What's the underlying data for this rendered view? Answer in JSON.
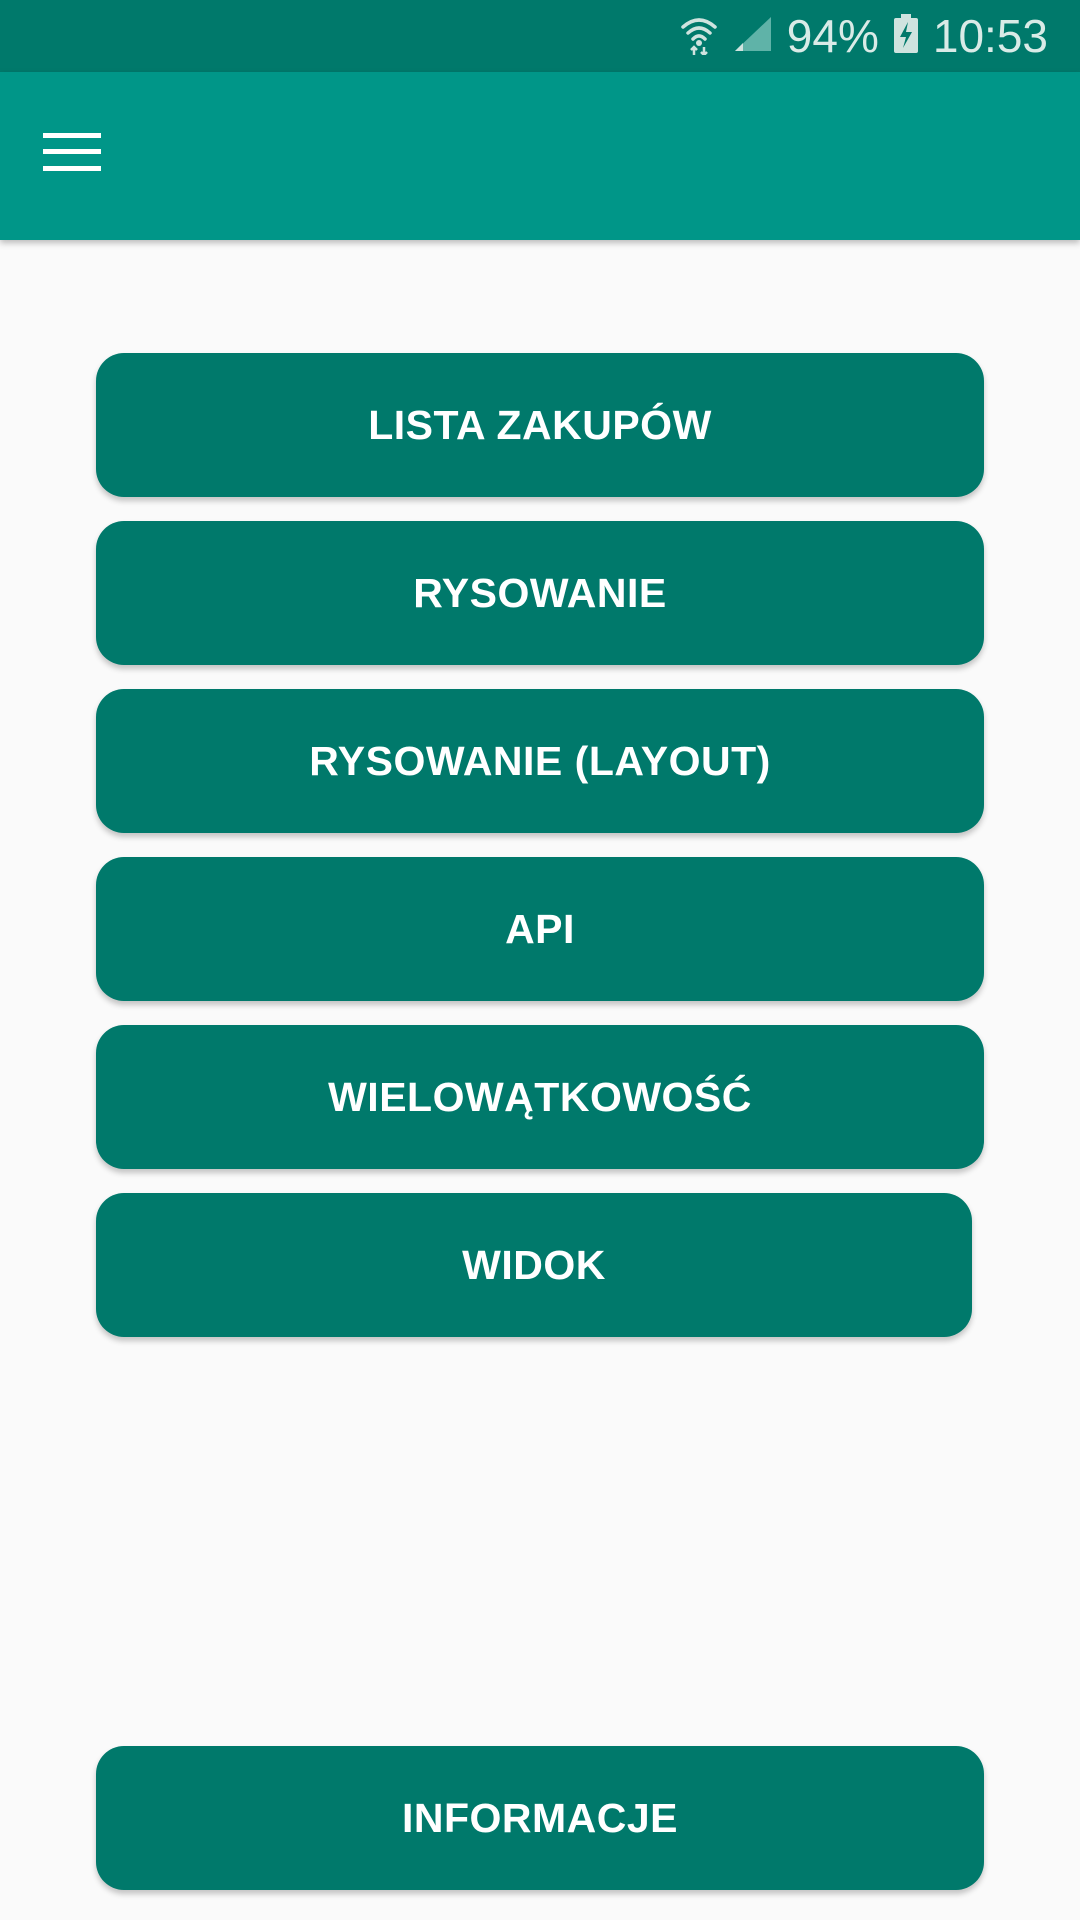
{
  "status_bar": {
    "battery": "94%",
    "time": "10:53",
    "icons": [
      "wifi-icon",
      "signal-icon",
      "battery-charging-icon"
    ]
  },
  "app_bar": {
    "menu_icon": "hamburger-menu-icon",
    "color": "#009688"
  },
  "buttons": [
    {
      "label": "LISTA ZAKUPÓW"
    },
    {
      "label": "RYSOWANIE"
    },
    {
      "label": "RYSOWANIE (LAYOUT)"
    },
    {
      "label": "API"
    },
    {
      "label": "WIELOWĄTKOWOŚĆ"
    },
    {
      "label": "WIDOK"
    }
  ],
  "footer_button": {
    "label": "INFORMACJE"
  },
  "colors": {
    "status_bar": "#00796b",
    "app_bar": "#009688",
    "button": "#00796b",
    "background": "#fafafa"
  }
}
